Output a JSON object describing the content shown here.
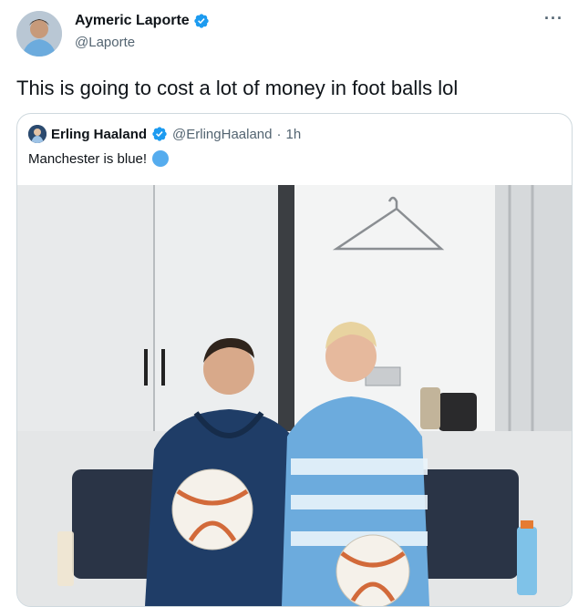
{
  "tweet": {
    "display_name": "Aymeric Laporte",
    "handle": "@Laporte",
    "text": "This is going to cost a lot of money in foot balls lol",
    "more_label": "···"
  },
  "quote": {
    "display_name": "Erling Haaland",
    "handle": "@ErlingHaaland",
    "separator": "·",
    "time": "1h",
    "text": "Manchester is blue!",
    "emoji": "blue-circle"
  },
  "photo": {
    "description_icon": "photo-two-players-with-signed-balls",
    "brand_color": "#6cabdd"
  },
  "colors": {
    "verified": "#1d9bf0",
    "secondary_text": "#536471",
    "border": "#cfd9de"
  }
}
